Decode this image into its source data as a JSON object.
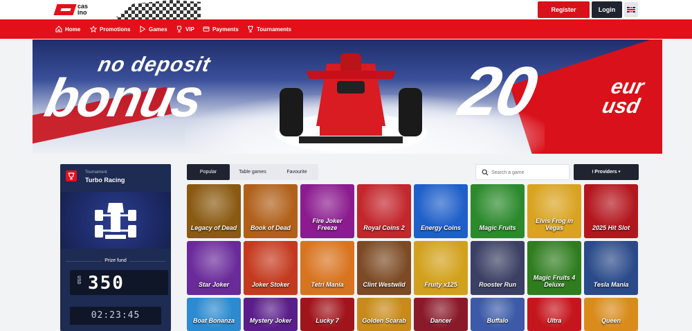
{
  "header": {
    "logo_text": "cas ino",
    "register_label": "Register",
    "login_label": "Login"
  },
  "nav": [
    "Home",
    "Promotions",
    "Games",
    "VIP",
    "Payments",
    "Tournaments"
  ],
  "banner": {
    "line1": "no deposit",
    "line2": "bonus",
    "amount": "20",
    "currency": "eur usd"
  },
  "tournament": {
    "label": "Tournament",
    "name": "Turbo Racing",
    "prize_label": "Prize fund",
    "currency": "USD",
    "amount": "350",
    "timer": "02:23:45"
  },
  "tabs": [
    "Popular",
    "Table games",
    "Favourite"
  ],
  "search": {
    "placeholder": "Search a game"
  },
  "providers_label": "Providers",
  "games": [
    {
      "title": "Legacy of Dead",
      "color": "#8a5a12"
    },
    {
      "title": "Book of Dead",
      "color": "#b0601a"
    },
    {
      "title": "Fire Joker Freeze",
      "color": "#8b1b8f"
    },
    {
      "title": "Royal Coins 2",
      "color": "#c2272d"
    },
    {
      "title": "Energy Coins",
      "color": "#1f5fc9"
    },
    {
      "title": "Magic Fruits",
      "color": "#2c8a2d"
    },
    {
      "title": "Elvis Frog in Vegas",
      "color": "#d9a320"
    },
    {
      "title": "2025 Hit Slot",
      "color": "#b3171e"
    },
    {
      "title": "Star Joker",
      "color": "#6a2a9a"
    },
    {
      "title": "Joker Stoker",
      "color": "#c43a1f"
    },
    {
      "title": "Tetri Mania",
      "color": "#d8741f"
    },
    {
      "title": "Clint Westwild",
      "color": "#7c4b25"
    },
    {
      "title": "Fruity x125",
      "color": "#d2a11b"
    },
    {
      "title": "Rooster Run",
      "color": "#3b3f63"
    },
    {
      "title": "Magic Fruits 4 Deluxe",
      "color": "#2f7d1f"
    },
    {
      "title": "Tesla Mania",
      "color": "#2b4a8a"
    },
    {
      "title": "Boat Bonanza",
      "color": "#2b8ad0"
    },
    {
      "title": "Mystery Joker",
      "color": "#5a1d8a"
    },
    {
      "title": "Lucky 7",
      "color": "#a0151b"
    },
    {
      "title": "Golden Scarab",
      "color": "#c98a1a"
    },
    {
      "title": "Dancer",
      "color": "#8a1a2a"
    },
    {
      "title": "Buffalo",
      "color": "#3c5aa8"
    },
    {
      "title": "Ultra",
      "color": "#c5161d"
    },
    {
      "title": "Queen",
      "color": "#d98b1c"
    }
  ]
}
